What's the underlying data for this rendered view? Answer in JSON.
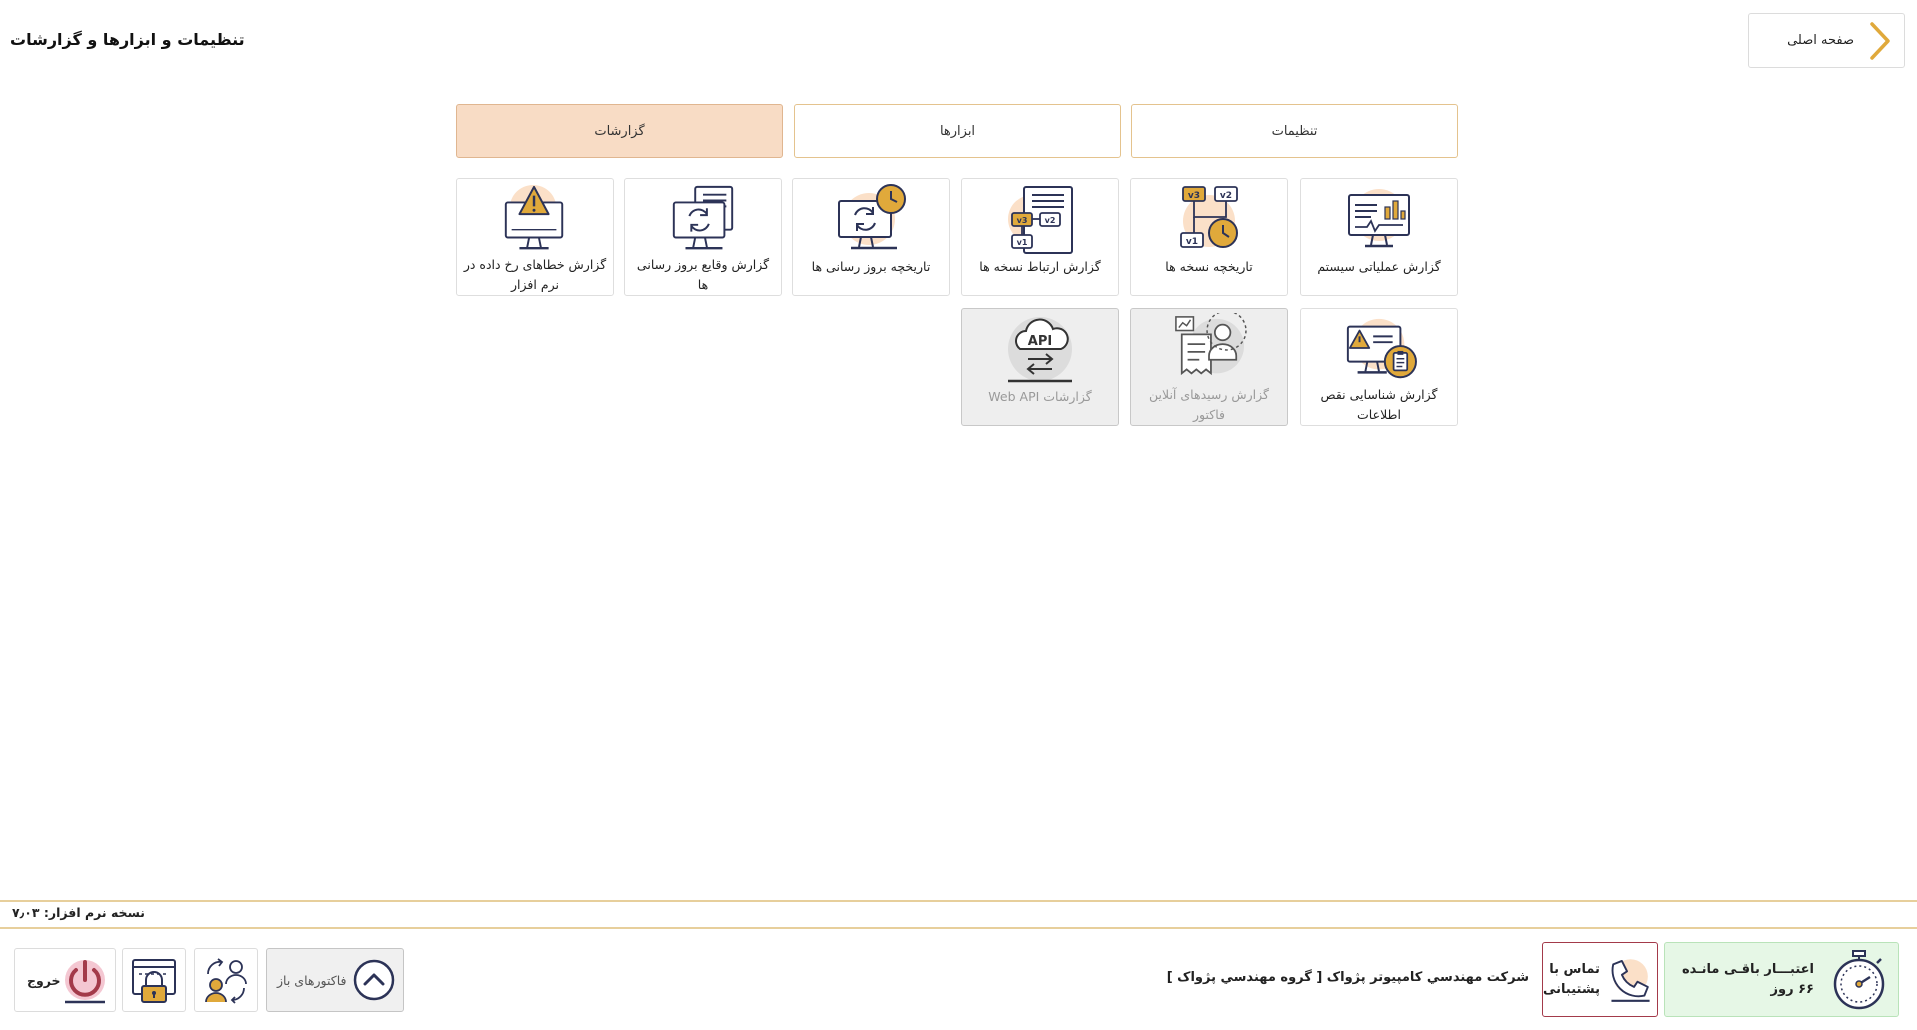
{
  "header": {
    "title": "تنظیمات و ابزارها و گزارشات",
    "home_label": "صفحه اصلی"
  },
  "tabs": [
    {
      "label": "تنظیمات",
      "active": false
    },
    {
      "label": "ابزارها",
      "active": false
    },
    {
      "label": "گزارشات",
      "active": true
    }
  ],
  "tiles": [
    {
      "label": "گزارش عملیاتی سیستم",
      "icon": "monitor-chart-icon",
      "enabled": true
    },
    {
      "label": "تاریخچه نسخه ها",
      "icon": "version-tree-clock-icon",
      "enabled": true
    },
    {
      "label": "گزارش ارتباط نسخه ها",
      "icon": "version-links-document-icon",
      "enabled": true
    },
    {
      "label": "تاریخچه بروز رسانی ها",
      "icon": "monitor-sync-clock-icon",
      "enabled": true
    },
    {
      "label": "گزارش وقایع بروز رسانی ها",
      "icon": "monitor-sync-document-icon",
      "enabled": true
    },
    {
      "label": "گزارش خطاهای رخ داده در نرم افزار",
      "icon": "monitor-warning-icon",
      "enabled": true
    },
    {
      "label": "گزارش شناسایی نقص اطلاعات",
      "icon": "monitor-warning-clipboard-icon",
      "enabled": true
    },
    {
      "label": "گزارش رسیدهای آنلاین فاکتور",
      "icon": "receipt-person-icon",
      "enabled": false
    },
    {
      "label": "گزارشات Web API",
      "icon": "cloud-api-icon",
      "enabled": false
    }
  ],
  "footer": {
    "version": "نسخه نرم افزار: ۷٫۰۳",
    "credit": {
      "line1": "اعتبـــار باقـی مانـده",
      "line2": "۶۶ روز"
    },
    "support": {
      "line1": "تماس با",
      "line2": "پشتیبانی"
    },
    "company": "شرکت مهندسي کامپيوتر پژواک [ گروه مهندسي پژواک ]",
    "open_invoices_label": "فاکتورهای باز",
    "exit_label": "خروج"
  },
  "colors": {
    "accent": "#e0a93b",
    "navy": "#2c3357",
    "tab_border": "#e4c38e",
    "tab_active_bg": "#f8dcc5",
    "icon_blob": "#fbe0c8",
    "credit_bg": "#e6f7e6",
    "support_border": "#a33a4a"
  }
}
